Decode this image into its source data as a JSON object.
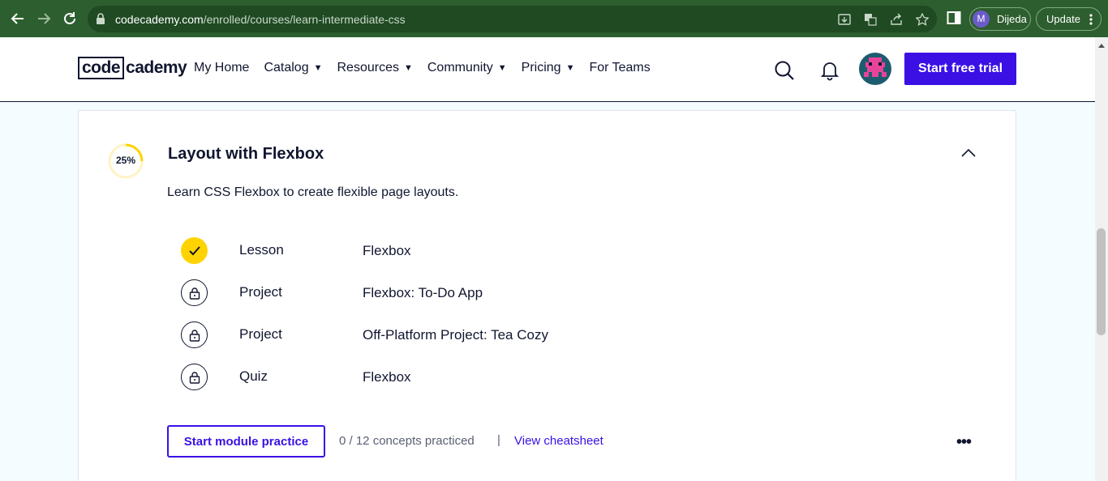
{
  "browser": {
    "url_host": "codecademy.com",
    "url_path": "/enrolled/courses/learn-intermediate-css",
    "profile_initial": "M",
    "profile_name": "Dijeda",
    "update_label": "Update"
  },
  "header": {
    "logo_boxed": "code",
    "logo_rest": "cademy",
    "nav": [
      {
        "label": "My Home",
        "has_caret": false
      },
      {
        "label": "Catalog",
        "has_caret": true
      },
      {
        "label": "Resources",
        "has_caret": true
      },
      {
        "label": "Community",
        "has_caret": true
      },
      {
        "label": "Pricing",
        "has_caret": true
      },
      {
        "label": "For Teams",
        "has_caret": false
      }
    ],
    "cta_label": "Start free trial"
  },
  "module": {
    "progress_label": "25%",
    "progress_fraction": 0.25,
    "title": "Layout with Flexbox",
    "description": "Learn CSS Flexbox to create flexible page layouts.",
    "items": [
      {
        "type": "Lesson",
        "name": "Flexbox",
        "status": "completed"
      },
      {
        "type": "Project",
        "name": "Flexbox: To-Do App",
        "status": "locked"
      },
      {
        "type": "Project",
        "name": "Off-Platform Project: Tea Cozy",
        "status": "locked"
      },
      {
        "type": "Quiz",
        "name": "Flexbox",
        "status": "locked"
      }
    ],
    "practice_button": "Start module practice",
    "concepts_text": "0 / 12 concepts practiced",
    "separator": "|",
    "cheatsheet_link": "View cheatsheet",
    "more_label": "•••"
  },
  "colors": {
    "accent": "#3a10e5",
    "progress": "#ffd300",
    "text": "#10162f",
    "chrome": "#2d5e2f"
  }
}
